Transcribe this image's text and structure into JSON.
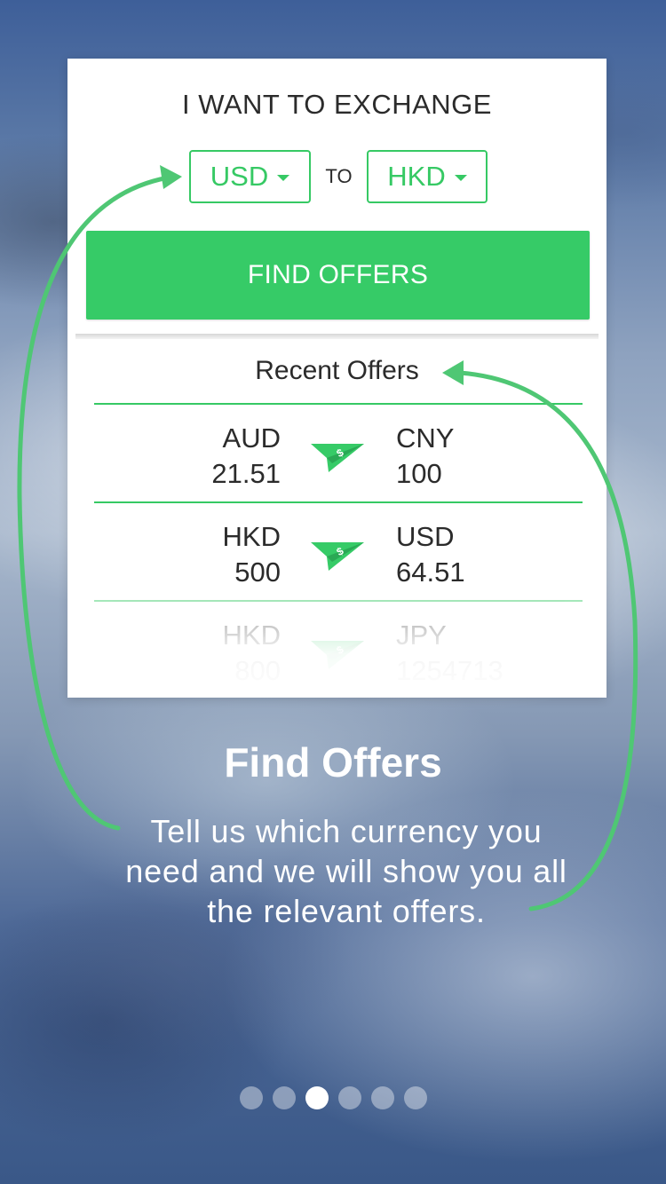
{
  "exchange": {
    "heading": "I WANT TO EXCHANGE",
    "from_currency": "USD",
    "to_label": "TO",
    "to_currency": "HKD",
    "find_button": "FIND OFFERS"
  },
  "recent": {
    "title": "Recent Offers",
    "offers": [
      {
        "from_currency": "AUD",
        "from_amount": "21.51",
        "to_currency": "CNY",
        "to_amount": "100"
      },
      {
        "from_currency": "HKD",
        "from_amount": "500",
        "to_currency": "USD",
        "to_amount": "64.51"
      },
      {
        "from_currency": "HKD",
        "from_amount": "800",
        "to_currency": "JPY",
        "to_amount": "1254713"
      }
    ]
  },
  "caption": {
    "title": "Find Offers",
    "text": "Tell us which currency you need and we will show you all the relevant offers."
  },
  "pagination": {
    "total": 6,
    "active_index": 2
  },
  "colors": {
    "accent": "#36cb67",
    "text": "#2b2b2b"
  },
  "icons": {
    "offer": "paper-plane-money-icon",
    "dropdown": "caret-down-icon"
  }
}
